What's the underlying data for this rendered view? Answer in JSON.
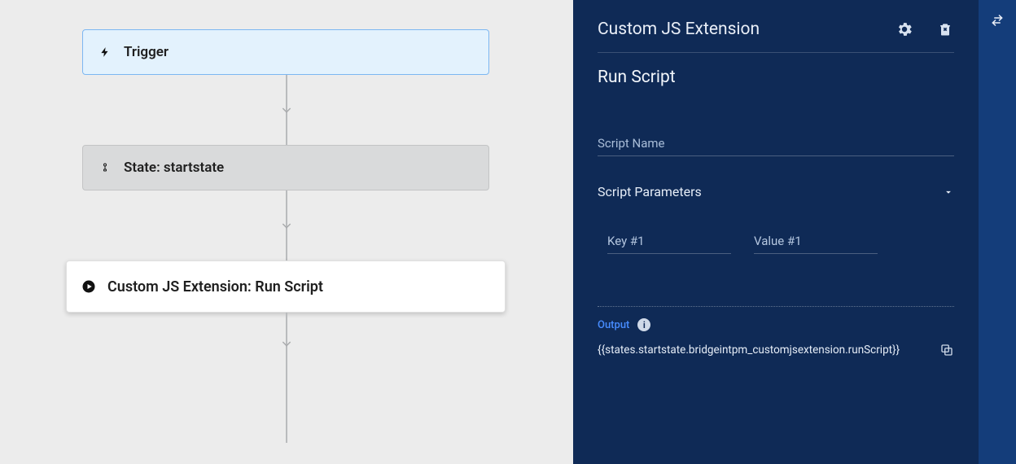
{
  "canvas": {
    "nodes": {
      "trigger": {
        "label": "Trigger"
      },
      "state": {
        "label": "State: startstate"
      },
      "action": {
        "label": "Custom JS Extension: Run Script"
      }
    }
  },
  "panel": {
    "title": "Custom JS Extension",
    "subtitle": "Run Script",
    "script_name_label": "Script Name",
    "parameters_label": "Script Parameters",
    "kv": {
      "key_placeholder": "Key #1",
      "value_placeholder": "Value #1"
    },
    "output": {
      "label": "Output",
      "expression": "{{states.startstate.bridgeintpm_customjsextension.runScript}}"
    }
  },
  "icons": {
    "gear": "settings",
    "delete": "delete",
    "swap": "swap",
    "info": "i"
  }
}
